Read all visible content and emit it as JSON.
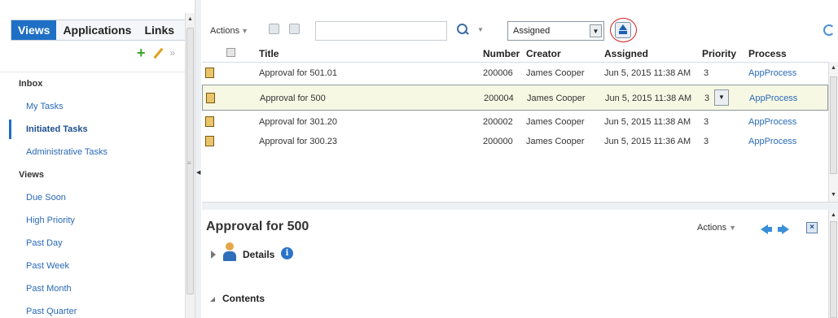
{
  "left_panel": {
    "tabs": [
      {
        "label": "Views",
        "active": true
      },
      {
        "label": "Applications",
        "active": false
      },
      {
        "label": "Links",
        "active": false
      }
    ],
    "sections": [
      {
        "heading": "Inbox",
        "items": [
          "My Tasks",
          "Initiated Tasks",
          "Administrative Tasks"
        ]
      },
      {
        "heading": "Views",
        "items": [
          "Due Soon",
          "High Priority",
          "Past Day",
          "Past Week",
          "Past Month",
          "Past Quarter"
        ]
      }
    ],
    "selected_item": "Initiated Tasks"
  },
  "toolbar": {
    "actions_label": "Actions",
    "search_value": "",
    "filter_selected": "Assigned"
  },
  "table": {
    "columns": [
      "Title",
      "Number",
      "Creator",
      "Assigned",
      "Priority",
      "Process"
    ],
    "rows": [
      {
        "title": "Approval for 501.01",
        "number": "200006",
        "creator": "James Cooper",
        "assigned": "Jun 5, 2015 11:38 AM",
        "priority": "3",
        "process": "AppProcess",
        "selected": false
      },
      {
        "title": "Approval for 500",
        "number": "200004",
        "creator": "James Cooper",
        "assigned": "Jun 5, 2015 11:38 AM",
        "priority": "3",
        "process": "AppProcess",
        "selected": true
      },
      {
        "title": "Approval for 301.20",
        "number": "200002",
        "creator": "James Cooper",
        "assigned": "Jun 5, 2015 11:38 AM",
        "priority": "3",
        "process": "AppProcess",
        "selected": false
      },
      {
        "title": "Approval for 300.23",
        "number": "200000",
        "creator": "James Cooper",
        "assigned": "Jun 5, 2015 11:36 AM",
        "priority": "3",
        "process": "AppProcess",
        "selected": false
      }
    ]
  },
  "detail": {
    "title": "Approval for 500",
    "actions_label": "Actions",
    "details_label": "Details",
    "contents_label": "Contents"
  },
  "colors": {
    "accent": "#1f6fc5",
    "link": "#2a6ab8",
    "highlight_circle": "#d21f1f",
    "selected_row": "#f7f8e4"
  },
  "icons": {
    "row_task": "task-icon",
    "upload": "upload-icon",
    "refresh": "refresh-icon",
    "info": "info-icon",
    "user": "user-icon"
  }
}
